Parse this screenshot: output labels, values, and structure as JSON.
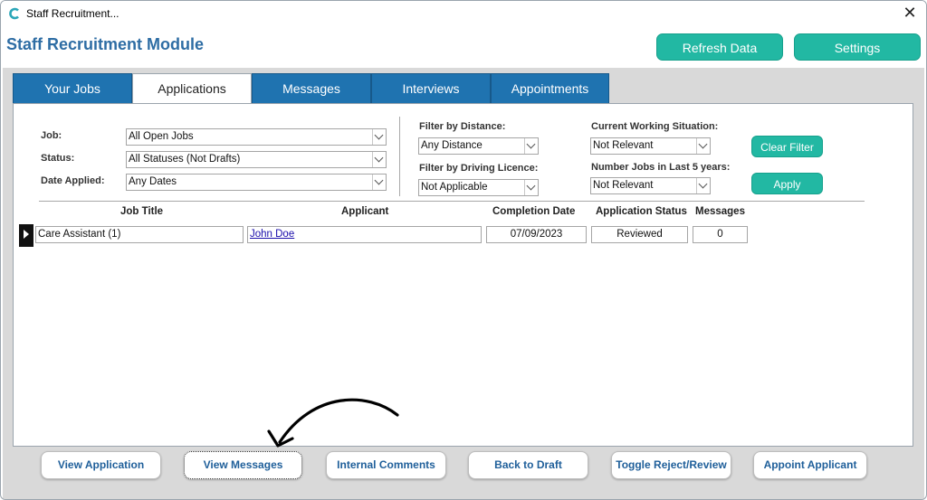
{
  "window": {
    "title": "Staff Recruitment..."
  },
  "header": {
    "module_title": "Staff Recruitment Module",
    "refresh_label": "Refresh Data",
    "settings_label": "Settings"
  },
  "tabs": [
    {
      "label": "Your Jobs",
      "active": false
    },
    {
      "label": "Applications",
      "active": true
    },
    {
      "label": "Messages",
      "active": false
    },
    {
      "label": "Interviews",
      "active": false
    },
    {
      "label": "Appointments",
      "active": false
    }
  ],
  "filters": {
    "job_label": "Job:",
    "job_value": "All Open Jobs",
    "status_label": "Status:",
    "status_value": "All Statuses (Not Drafts)",
    "date_label": "Date Applied:",
    "date_value": "Any Dates",
    "distance_label": "Filter by Distance:",
    "distance_value": "Any Distance",
    "licence_label": "Filter by Driving Licence:",
    "licence_value": "Not Applicable",
    "working_label": "Current Working Situation:",
    "working_value": "Not Relevant",
    "jobs5_label": "Number Jobs in Last 5 years:",
    "jobs5_value": "Not Relevant",
    "clear_label": "Clear Filter",
    "apply_label": "Apply"
  },
  "table": {
    "columns": [
      "Job Title",
      "Applicant",
      "Completion Date",
      "Application Status",
      "Messages"
    ],
    "rows": [
      {
        "job_title": "Care Assistant (1)",
        "applicant": "John Doe",
        "completion_date": "07/09/2023",
        "status": "Reviewed",
        "messages": "0"
      }
    ]
  },
  "footer": {
    "buttons": [
      "View Application",
      "View Messages",
      "Internal Comments",
      "Back to Draft",
      "Toggle Reject/Review",
      "Appoint Applicant"
    ]
  },
  "colors": {
    "accent": "#22b8a3",
    "tab": "#1f73b0",
    "title": "#2e6da4"
  }
}
